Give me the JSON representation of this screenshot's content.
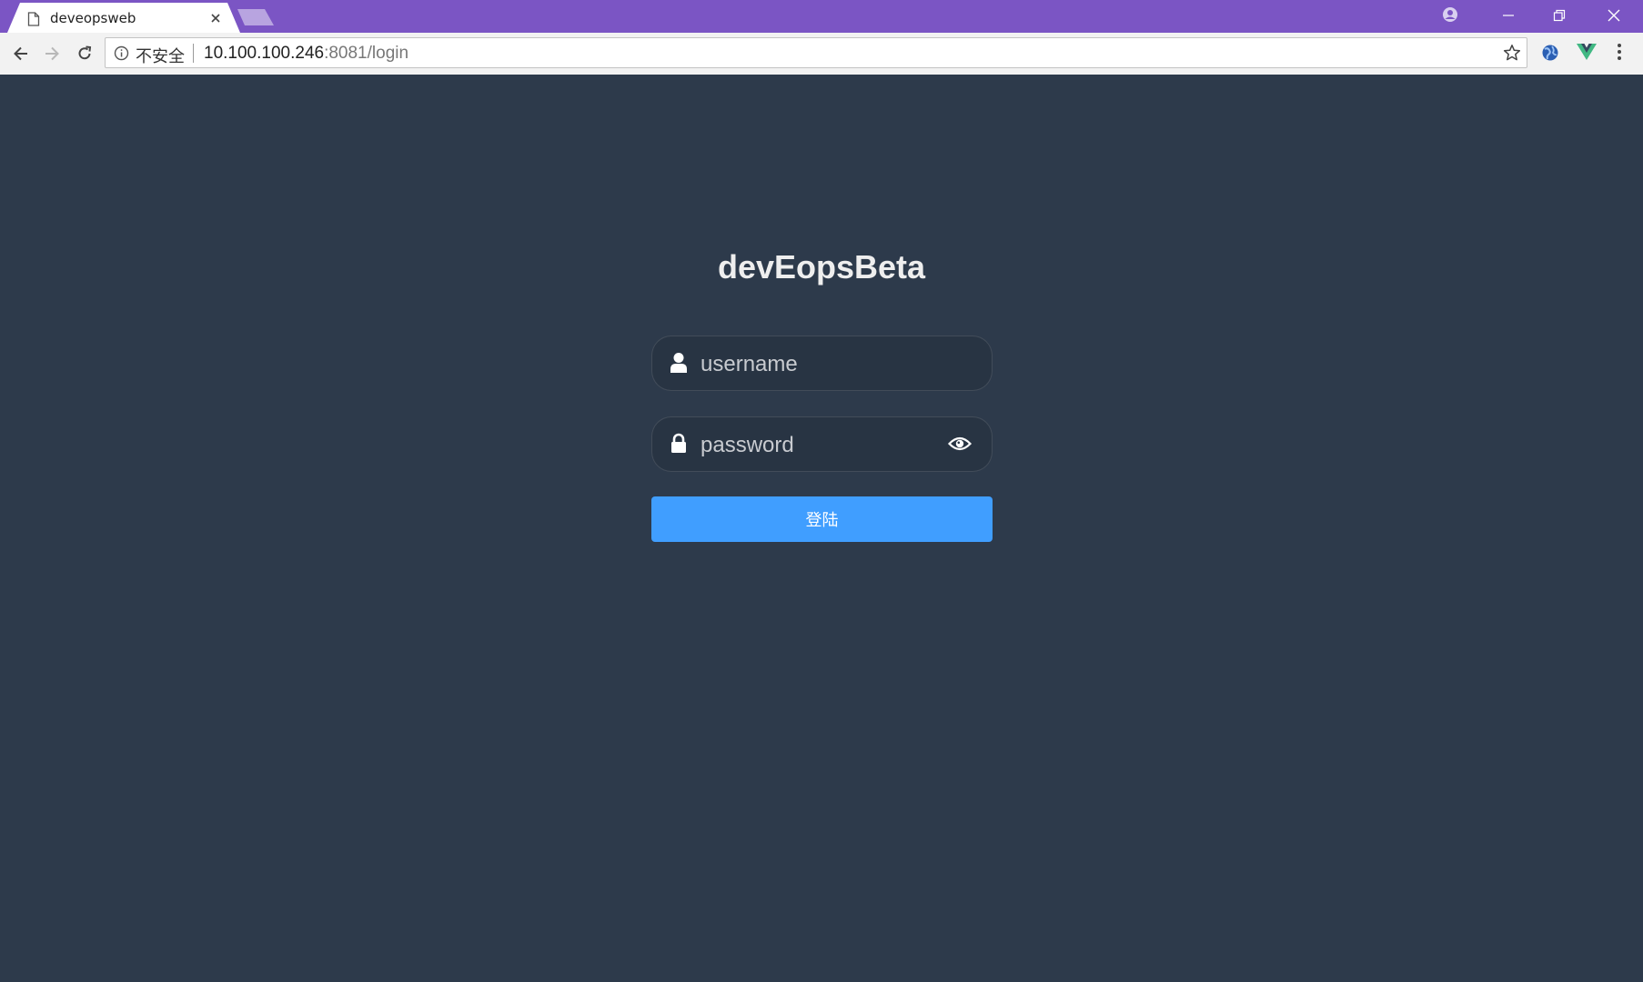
{
  "browser": {
    "tab_title": "deveopsweb",
    "security_label": "不安全",
    "url_host": "10.100.100.246",
    "url_rest": ":8081/login",
    "colors": {
      "titlebar": "#7b55c4",
      "toolbar": "#f2f2f2"
    },
    "icons": [
      "page-icon",
      "tab-close-icon",
      "new-tab-icon",
      "profile-icon",
      "minimize-icon",
      "restore-icon",
      "window-close-icon",
      "back-icon",
      "forward-icon",
      "reload-icon",
      "info-icon",
      "star-icon",
      "globe-extension-icon",
      "vue-devtools-icon",
      "menu-icon"
    ]
  },
  "login": {
    "title": "devEopsBeta",
    "username_placeholder": "username",
    "password_placeholder": "password",
    "button_label": "登陆",
    "colors": {
      "background": "#2d3a4b",
      "field": "#283443",
      "button": "#409eff"
    },
    "icons": [
      "user-icon",
      "lock-icon",
      "eye-icon"
    ]
  }
}
